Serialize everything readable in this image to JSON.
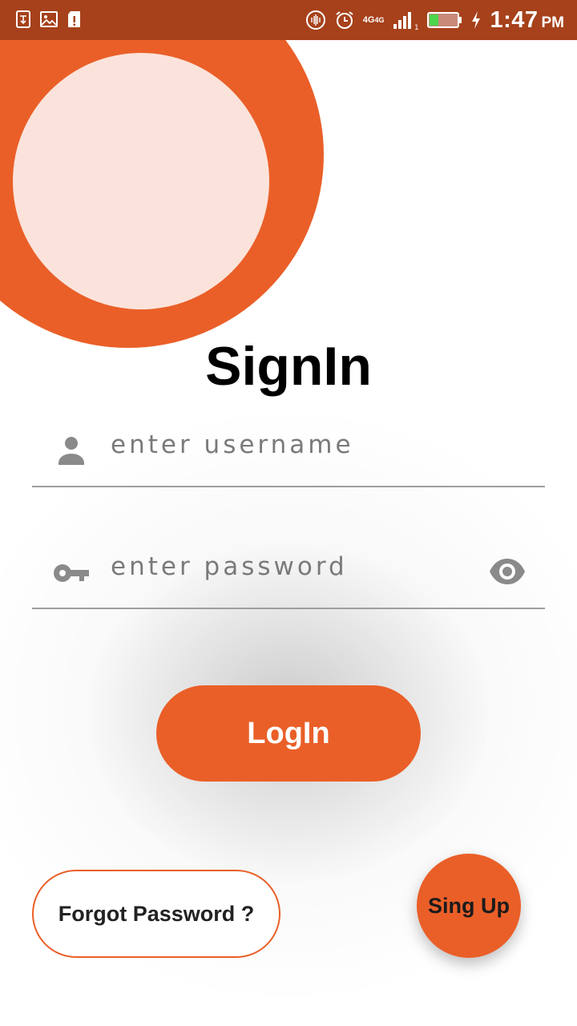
{
  "status_bar": {
    "time": "1:47",
    "ampm": "PM",
    "network": "4G",
    "network2": "4G",
    "sim_slot": "1",
    "icons": [
      "usb-icon",
      "image-icon",
      "sd-card-icon",
      "vibrate-icon",
      "alarm-icon",
      "signal-icon",
      "battery-icon",
      "charging-icon"
    ]
  },
  "colors": {
    "accent": "#ea5f28",
    "accent_light": "#fbe3db",
    "status_bar": "#a6411b"
  },
  "title": "SignIn",
  "username": {
    "placeholder": "enter username",
    "value": "",
    "icon": "person-icon"
  },
  "password": {
    "placeholder": "enter password",
    "value": "",
    "icon": "key-icon",
    "toggle_icon": "eye-icon"
  },
  "buttons": {
    "login": "LogIn",
    "forgot": "Forgot Password ?",
    "signup": "Sing Up"
  }
}
